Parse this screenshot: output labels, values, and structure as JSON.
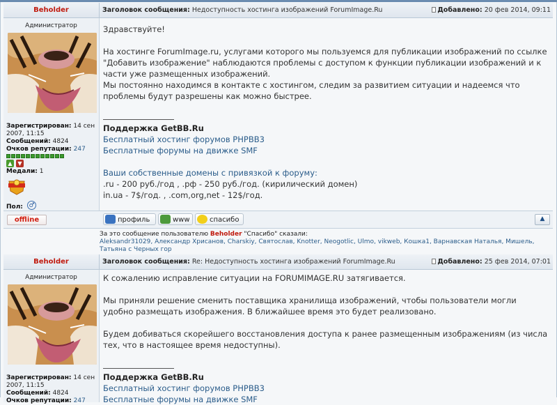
{
  "posts": [
    {
      "author": "Beholder",
      "rank": "Администратор",
      "subject_label": "Заголовок сообщения:",
      "subject": "Недоступность хостинга изображений ForumImage.Ru",
      "date_label": "Добавлено:",
      "date": "20 фев 2014, 09:11",
      "registered_label": "Зарегистрирован:",
      "registered": "14 сен 2007, 11:15",
      "messages_label": "Сообщений:",
      "messages": "4824",
      "rep_label": "Очков репутации:",
      "rep": "247",
      "medals_label": "Медали:",
      "medals": "1",
      "gender_label": "Пол:",
      "body": [
        "Здравствуйте!",
        "На хостинге ForumImage.ru, услугами которого мы пользуемся для публикации изображений по ссылке \"Добавить изображение\" наблюдаются проблемы с доступом к функции публикации изображений и к части уже размещенных изображений.",
        "Мы постоянно находимся в контакте с хостингом, следим за развитием ситуации и надеемся что проблемы будут разрешены как можно быстрее."
      ]
    },
    {
      "author": "Beholder",
      "rank": "Администратор",
      "subject_label": "Заголовок сообщения:",
      "subject": "Re: Недоступность хостинга изображений ForumImage.Ru",
      "date_label": "Добавлено:",
      "date": "25 фев 2014, 07:01",
      "registered_label": "Зарегистрирован:",
      "registered": "14 сен 2007, 11:15",
      "messages_label": "Сообщений:",
      "messages": "4824",
      "rep_label": "Очков репутации:",
      "rep": "247",
      "body": [
        "К сожалению исправление ситуации на FORUMIMAGE.RU затягивается.",
        "Мы приняли решение сменить поставщика хранилища изображений, чтобы пользователи могли удобно размещать изображения. В ближайшее время это будет реализовано.",
        "Будем добиваться скорейшего восстановления доступа к ранее размещенным изображениям (из числа тех, что в настоящее время недоступны)."
      ]
    }
  ],
  "signature": {
    "title": "Поддержка GetBB.Ru",
    "link1": "Бесплатный хостинг форумов PHPBB3",
    "link2": "Бесплатные форумы на движке SMF",
    "domains_link": "Ваши собственные домены с привязкой к форуму:",
    "line1": ".ru - 200 руб./год , .рф - 250 руб./год. (кирилический домен)",
    "line2": "in.ua - 7$/год. , .com,org,net - 12$/год."
  },
  "footer": {
    "offline": "offline",
    "profile": "профиль",
    "www": "www",
    "thanks": "спасибо",
    "up": "▲"
  },
  "thanks_block": {
    "prefix": "За это сообщение пользователю",
    "user": "Beholder",
    "middle": "\"Спасибо\" сказали:",
    "names": "Aleksandr31029, Александр Хрисанов, Charskiy, Святослав, Knotter, Neogotlic, Ulmo, vikweb, Кошка1, Варнавская Наталья, Мишель, Татьяна с Черных гор"
  },
  "colors": {
    "author": "#c01a0e",
    "link": "#2a5c8a",
    "header_bg": "#dfe6ee"
  }
}
